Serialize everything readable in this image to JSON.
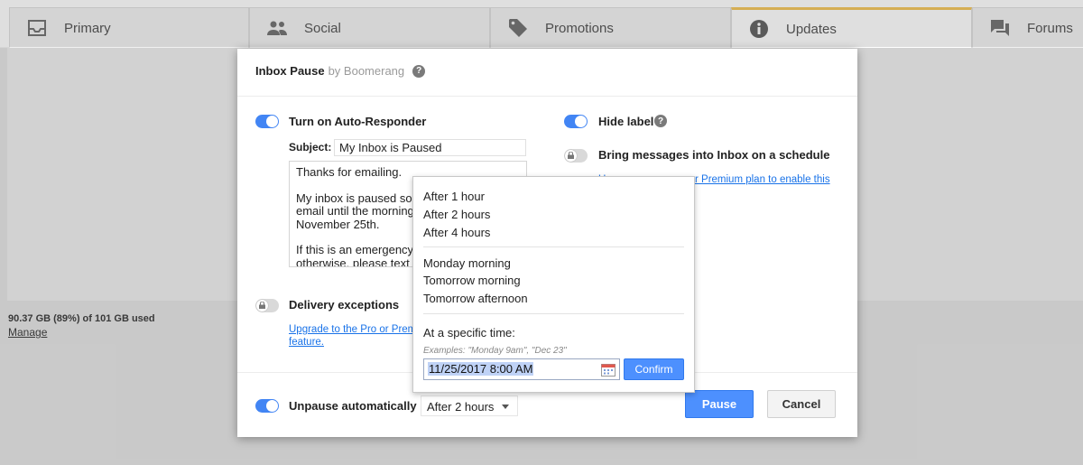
{
  "tabs": [
    {
      "label": "Primary",
      "icon": "inbox-icon"
    },
    {
      "label": "Social",
      "icon": "people-icon"
    },
    {
      "label": "Promotions",
      "icon": "tag-icon"
    },
    {
      "label": "Updates",
      "icon": "info-icon",
      "active": true
    },
    {
      "label": "Forums",
      "icon": "forum-icon"
    }
  ],
  "storage": {
    "used": "90.37 GB (89%) of 101 GB used",
    "manage": "Manage"
  },
  "dialog": {
    "title": "Inbox Pause",
    "byline": "by Boomerang",
    "help": "?",
    "auto_responder": {
      "label": "Turn on Auto-Responder",
      "enabled": true,
      "subject_label": "Subject:",
      "subject_value": "My Inbox is Paused",
      "body_lines": [
        "Thanks for emailing.",
        "My inbox is paused so",
        "email until the morning",
        "November 25th.",
        "If this is an emergency,",
        "otherwise, please text"
      ]
    },
    "delivery": {
      "label": "Delivery exceptions",
      "enabled": false,
      "upgrade_line1": "Upgrade to the Pro or Prem",
      "upgrade_line2": "feature."
    },
    "hide_label": {
      "label": "Hide label",
      "enabled": true
    },
    "schedule": {
      "label": "Bring messages into Inbox on a schedule",
      "enabled": false,
      "upgrade_left": "U",
      "upgrade_right": "r Premium plan to enable this"
    },
    "unpause": {
      "label": "Unpause automatically",
      "enabled": true,
      "value": "After 2 hours"
    },
    "pause_button": "Pause",
    "cancel_button": "Cancel"
  },
  "popup": {
    "group1": [
      "After 1 hour",
      "After 2 hours",
      "After 4 hours"
    ],
    "group2": [
      "Monday morning",
      "Tomorrow morning",
      "Tomorrow afternoon"
    ],
    "specific_label": "At a specific time:",
    "examples": "Examples: \"Monday 9am\", \"Dec 23\"",
    "date_value": "11/25/2017 8:00 AM",
    "confirm": "Confirm"
  },
  "colors": {
    "accent": "#4285f4",
    "button": "#4d90fe",
    "link": "#1a73e8",
    "active_tab": "#f2c14e"
  }
}
